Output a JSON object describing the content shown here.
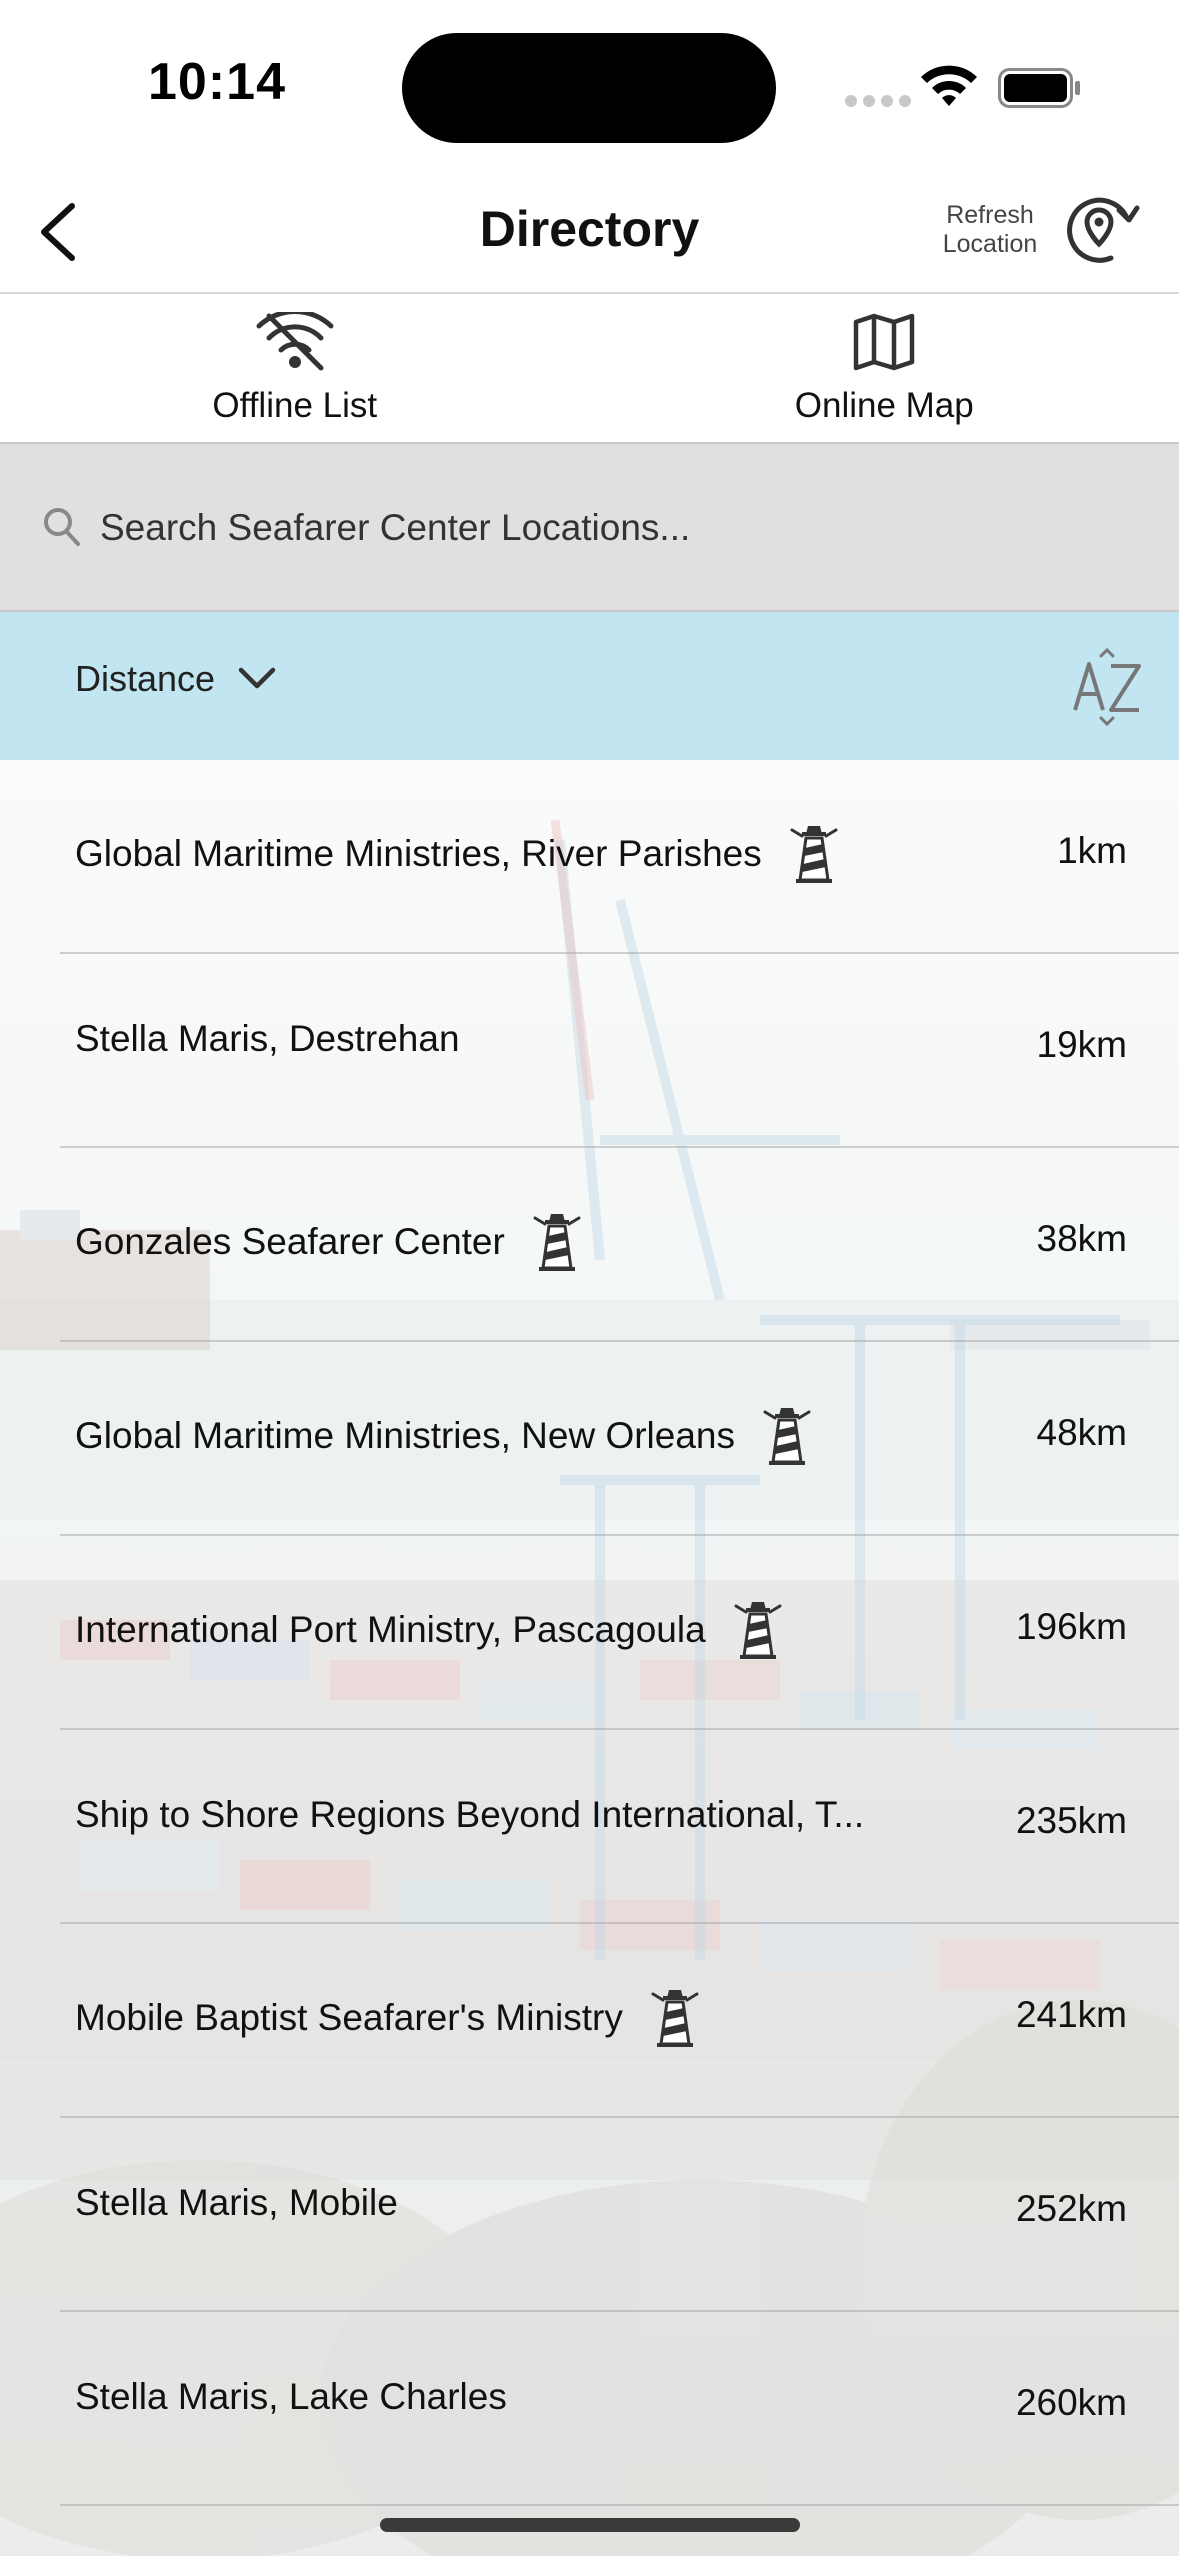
{
  "status_bar": {
    "time": "10:14"
  },
  "nav": {
    "title": "Directory",
    "refresh_line1": "Refresh",
    "refresh_line2": "Location"
  },
  "tabs": [
    {
      "label": "Offline List",
      "icon": "wifi-off-icon"
    },
    {
      "label": "Online Map",
      "icon": "map-icon"
    }
  ],
  "search": {
    "placeholder": "Search Seafarer Center Locations..."
  },
  "sort": {
    "label": "Distance",
    "az_icon": "sort-az-icon"
  },
  "colors": {
    "sort_bar": "#c2e6f1",
    "search_bar": "#e0e0e0"
  },
  "locations": [
    {
      "name": "Global Maritime Ministries, River Parishes",
      "distance": "1km",
      "lighthouse": true
    },
    {
      "name": "Stella Maris, Destrehan",
      "distance": "19km",
      "lighthouse": false
    },
    {
      "name": "Gonzales Seafarer Center",
      "distance": "38km",
      "lighthouse": true
    },
    {
      "name": "Global Maritime Ministries, New Orleans",
      "distance": "48km",
      "lighthouse": true
    },
    {
      "name": "International Port Ministry, Pascagoula",
      "distance": "196km",
      "lighthouse": true
    },
    {
      "name": "Ship to Shore Regions Beyond International, T...",
      "distance": "235km",
      "lighthouse": false
    },
    {
      "name": "Mobile Baptist Seafarer's Ministry",
      "distance": "241km",
      "lighthouse": true
    },
    {
      "name": "Stella Maris, Mobile",
      "distance": "252km",
      "lighthouse": false
    },
    {
      "name": "Stella Maris, Lake Charles",
      "distance": "260km",
      "lighthouse": false
    }
  ]
}
